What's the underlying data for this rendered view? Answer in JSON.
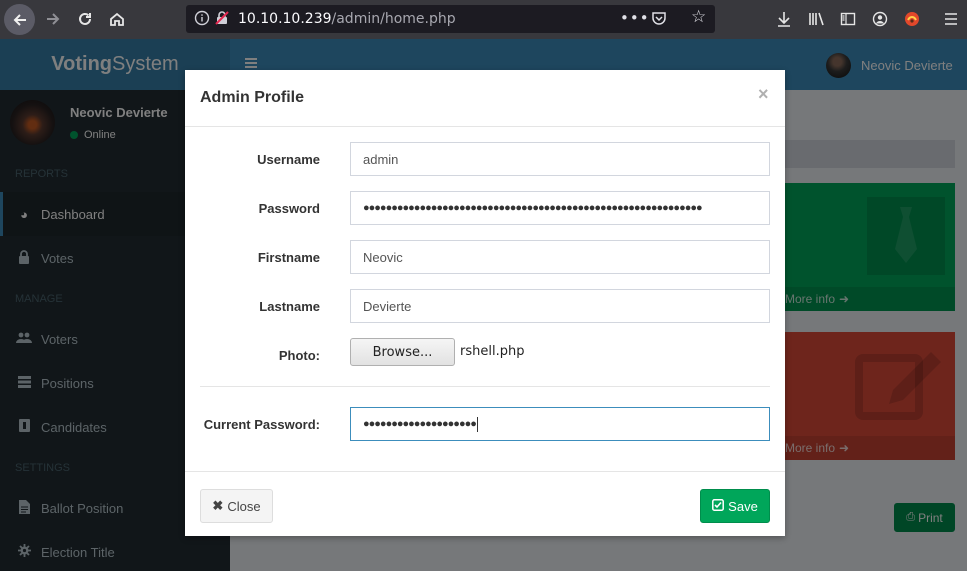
{
  "browser": {
    "url_host": "10.10.10.239",
    "url_path": "/admin/home.php",
    "more_dots": "•••"
  },
  "app": {
    "logo_bold": "Voting",
    "logo_regular": "System",
    "header_user_name": "Neovic Devierte"
  },
  "sidebar": {
    "user_name": "Neovic Devierte",
    "user_status": "Online",
    "headers": {
      "reports": "REPORTS",
      "manage": "MANAGE",
      "settings": "SETTINGS"
    },
    "items": [
      {
        "label": "Dashboard",
        "icon": "dashboard-icon"
      },
      {
        "label": "Votes",
        "icon": "lock-icon"
      },
      {
        "label": "Voters",
        "icon": "users-icon"
      },
      {
        "label": "Positions",
        "icon": "tasks-icon"
      },
      {
        "label": "Candidates",
        "icon": "id-card-icon"
      },
      {
        "label": "Ballot Position",
        "icon": "file-icon"
      },
      {
        "label": "Election Title",
        "icon": "cog-icon"
      }
    ]
  },
  "content": {
    "more_info_label": "More info",
    "print_label": "Print"
  },
  "modal": {
    "title": "Admin Profile",
    "close_symbol": "×",
    "fields": {
      "username_label": "Username",
      "username_value": "admin",
      "password_label": "Password",
      "password_value": "●●●●●●●●●●●●●●●●●●●●●●●●●●●●●●●●●●●●●●●●●●●●●●●●●●●●●●●●●●●●",
      "firstname_label": "Firstname",
      "firstname_value": "Neovic",
      "lastname_label": "Lastname",
      "lastname_value": "Devierte",
      "photo_label": "Photo:",
      "browse_label": "Browse...",
      "file_name": "rshell.php",
      "current_password_label": "Current Password:",
      "current_password_value": "●●●●●●●●●●●●●●●●●●●●"
    },
    "close_button_label": "Close",
    "save_button_label": "Save"
  }
}
